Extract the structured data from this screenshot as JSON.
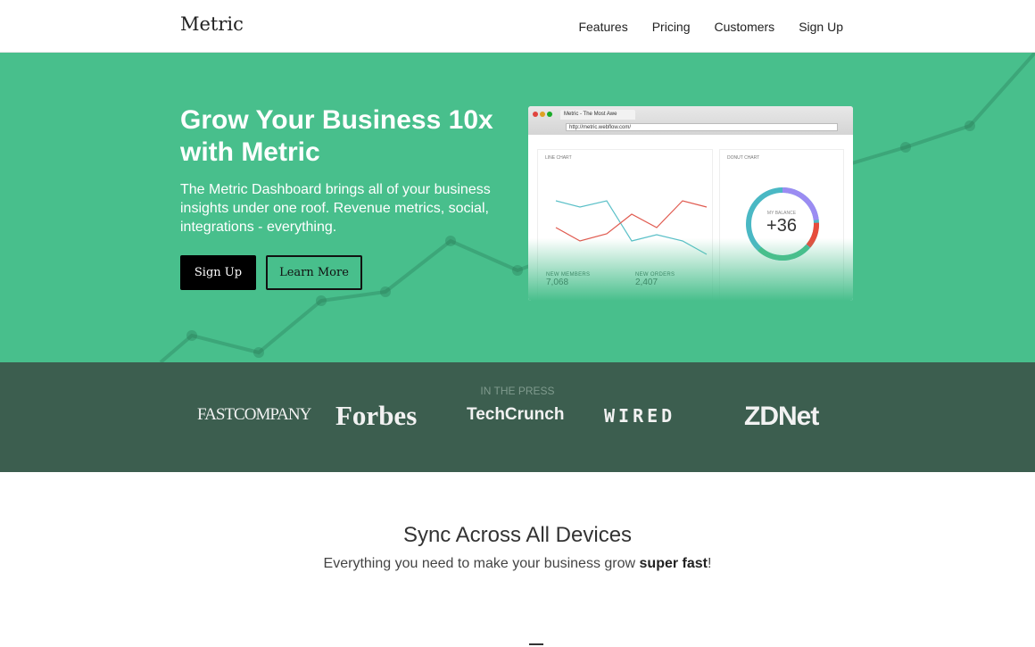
{
  "nav": {
    "logo": "Metric",
    "links": [
      "Features",
      "Pricing",
      "Customers",
      "Sign Up"
    ]
  },
  "hero": {
    "title": "Grow Your Business 10x with Metric",
    "lead": "The Metric Dashboard brings all of your business insights under one roof. Revenue metrics, social, integrations - everything.",
    "signup": "Sign Up",
    "learn_more": "Learn More",
    "screenshot": {
      "tab_title": "Metric - The Most Awe",
      "url": "http://metric.webflow.com/",
      "line_chart_title": "LINE CHART",
      "donut_chart_title": "DONUT CHART",
      "balance_label": "MY BALANCE",
      "balance_value": "+36",
      "stat1_label": "NEW MEMBERS",
      "stat1_value": "7,068",
      "stat2_label": "NEW ORDERS",
      "stat2_value": "2,407"
    }
  },
  "press": {
    "label": "IN THE PRESS",
    "logos": [
      "FASTCOMPANY",
      "Forbes",
      "TechCrunch",
      "WIRED",
      "ZDNet"
    ]
  },
  "sync": {
    "title": "Sync Across All Devices",
    "subtitle": "Everything you need to make your business grow ",
    "subtitle_bold": "super fast",
    "subtitle_end": "!"
  },
  "colors": {
    "hero": "#48bf8c",
    "press": "#3c5e4f"
  }
}
